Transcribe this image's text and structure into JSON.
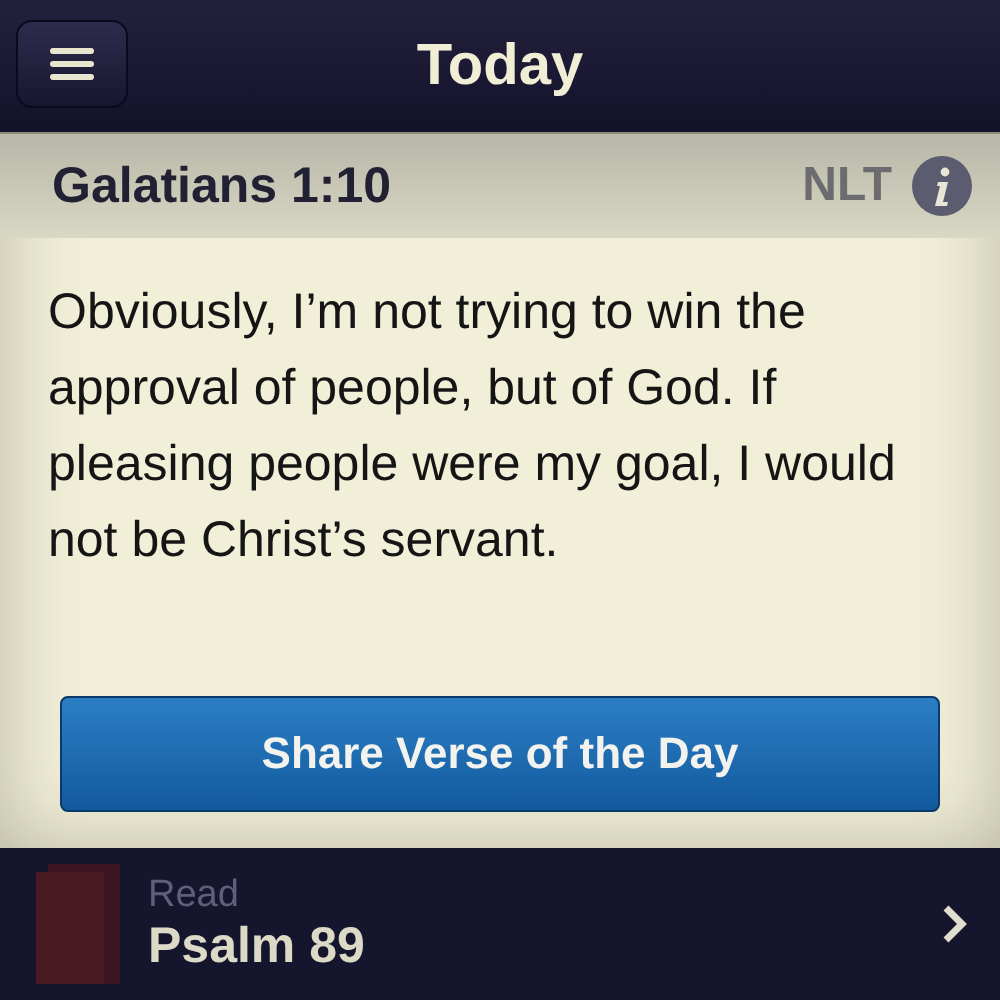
{
  "nav_bar": {
    "title": "Today"
  },
  "verse": {
    "reference": "Galatians 1:10",
    "translation": "NLT",
    "text": "Obviously, I’m not trying to win the approval of people, but of God. If pleasing people were my goal, I would not be Christ’s servant."
  },
  "share_button": {
    "label": "Share Verse of the Day"
  },
  "reading": {
    "caption": "Read",
    "title": "Psalm 89"
  }
}
